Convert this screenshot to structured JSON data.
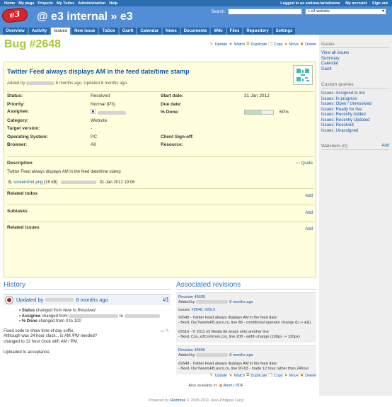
{
  "top_menu": {
    "left": [
      "Home",
      "My page",
      "Projects",
      "My Todos",
      "Administration",
      "Help"
    ],
    "logged_in": "Logged in as andrew.lansdowne",
    "my_account": "My account",
    "sign_out": "Sign out"
  },
  "header": {
    "logo_text": "e3",
    "title": "@ e3 internal » e3",
    "search_label": "Search:",
    "project_jump": "» e3 website"
  },
  "tabs": [
    "Overview",
    "Activity",
    "Issues",
    "New issue",
    "ToDos",
    "Gantt",
    "Calendar",
    "News",
    "Documents",
    "Wiki",
    "Files",
    "Repository",
    "Settings"
  ],
  "selected_tab": "Issues",
  "issue": {
    "title": "Bug #2648",
    "subject": "Twitter Feed always displays AM in the feed date/time stamp",
    "added_prefix": "Added by",
    "added_suffix": "8 months ago. Updated 8 months ago.",
    "attrs_left": [
      {
        "label": "Status:",
        "value": "Resolved"
      },
      {
        "label": "Priority:",
        "value": "Normal (P3)"
      },
      {
        "label": "Assignee:",
        "value": ""
      },
      {
        "label": "Category:",
        "value": "Website"
      },
      {
        "label": "Target version:",
        "value": "-"
      },
      {
        "label": "Operating System:",
        "value": "PC"
      },
      {
        "label": "Browser:",
        "value": "All"
      }
    ],
    "attrs_right": [
      {
        "label": "Start date:",
        "value": "31 Jan 2012"
      },
      {
        "label": "Due date:",
        "value": ""
      },
      {
        "label": "% Done:",
        "value": "60%"
      },
      {
        "label": "",
        "value": ""
      },
      {
        "label": "",
        "value": ""
      },
      {
        "label": "Client Sign-off:",
        "value": ""
      },
      {
        "label": "Resource:",
        "value": ""
      }
    ],
    "done_fraction": 0.6,
    "description_title": "Description",
    "quote": "Quote",
    "description": "Twitter Feed always displays AM in the feed date/time stamp",
    "attachment": "screenshot.png",
    "attachment_size": "(16 kB)",
    "attachment_date": "31 Jan 2012 19:08",
    "related_todos": "Related todos",
    "subtasks": "Subtasks",
    "related_issues": "Related issues",
    "add": "Add"
  },
  "actions": {
    "update": "Update",
    "watch": "Watch",
    "duplicate": "Duplicate",
    "copy": "Copy",
    "move": "Move",
    "delete": "Delete"
  },
  "history": {
    "title": "History",
    "updated_by": "Updated by",
    "ago": "8 months ago",
    "num": "#1",
    "details": [
      {
        "field": "Status",
        "text": " changed from ",
        "from": "New",
        "to": "Resolved"
      },
      {
        "field": "Assignee",
        "text": " changed from ",
        "from": "",
        "to": ""
      },
      {
        "field": "% Done",
        "text": " changed from ",
        "from": "0",
        "to": "100"
      }
    ],
    "notes": [
      "Fixed code to show time of day suffix.",
      "Although was 24 hour clock... is AM /PM needed?",
      "changed to 12 hour clock with AM / PM.",
      "",
      "Uploaded to acceptance."
    ]
  },
  "revisions": {
    "title": "Associated revisions",
    "items": [
      {
        "rev": "Revision 48695",
        "added": "Added by",
        "ago": "8 months ago",
        "issues": "issues: ",
        "issue_links": "#2648, #2519",
        "msgs": [
          "#2648 - Twitter Feed always displays AM in the feed date",
          "- fixed, OurTweetsFB.ascx.cs, line 88 - conditional operator change (|| -> &&)",
          "",
          "#2516 - © 2011 e3 Media ltd wraps onto another line",
          "- fixed, Css, e3Common.css, line 208 - width change (100px -> 120px)"
        ]
      },
      {
        "rev": "Revision 48696",
        "added": "Added by",
        "ago": "8 months ago",
        "issues": "",
        "issue_links": "",
        "msgs": [
          "#2648 - Twitter Feed always displays AM in the feed date",
          "- fixed, OurTweetsFB.ascx.cs, line 90-93 - made 12 hour rather than 24hour"
        ]
      }
    ]
  },
  "also_available": "Also available in:",
  "atom": "Atom",
  "pdf": "PDF",
  "sidebar": {
    "issues_title": "Issues",
    "issue_links": [
      "View all issues",
      "Summary",
      "Calendar",
      "Gantt"
    ],
    "queries_title": "Custom queries",
    "queries": [
      "Issues: Assigned to me",
      "Issues: In progress",
      "Issues: Open / Unresolved",
      "Issues: Ready for live",
      "Issues: Recently Added",
      "Issues: Recently Updated",
      "Issues: Resolved",
      "Issues: Unassigned"
    ],
    "watchers": "Watchers (0)",
    "add": "Add"
  },
  "footer": {
    "prefix": "Powered by",
    "redmine": "Redmine",
    "suffix": "© 2006-2011 Jean-Philippe Lang"
  }
}
